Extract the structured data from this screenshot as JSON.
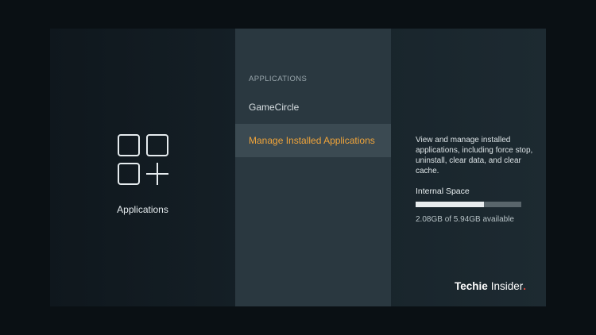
{
  "left": {
    "title": "Applications",
    "icon": "applications-grid-icon"
  },
  "menu": {
    "header": "APPLICATIONS",
    "items": [
      {
        "label": "GameCircle",
        "selected": false
      },
      {
        "label": "Manage Installed Applications",
        "selected": true
      }
    ],
    "selected_color": "#f0a43a"
  },
  "details": {
    "description": "View and manage installed applications, including force stop, uninstall, clear data, and clear cache.",
    "storage": {
      "label": "Internal Space",
      "used_fraction": 0.65,
      "text": "2.08GB of 5.94GB available"
    }
  },
  "watermark": {
    "part1": "Techie",
    "part2": "Insider",
    "dot": "."
  }
}
